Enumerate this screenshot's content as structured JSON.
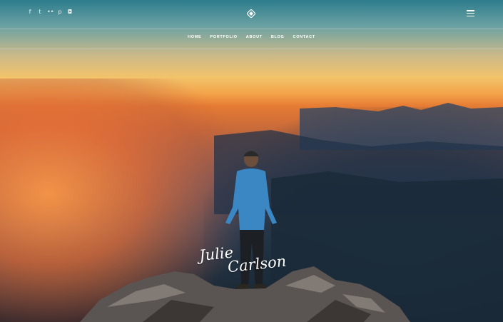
{
  "header": {
    "social_icons": [
      "facebook-icon",
      "twitter-icon",
      "flickr-icon",
      "pinterest-icon",
      "instagram-icon"
    ],
    "social_glyphs": [
      "f",
      "t",
      "••",
      "p",
      "◘"
    ],
    "logo": "diamond-logo-icon",
    "menu_icon": "hamburger-menu-icon"
  },
  "nav": {
    "items": [
      "HOME",
      "PORTFOLIO",
      "ABOUT",
      "BLOG",
      "CONTACT"
    ]
  },
  "hero": {
    "signature_line1": "Julie",
    "signature_line2": "Carlson"
  },
  "colors": {
    "sky_top": "#2d7c8c",
    "sunset": "#f3a44a",
    "haze": "#e57b33",
    "valley": "#23313f"
  }
}
